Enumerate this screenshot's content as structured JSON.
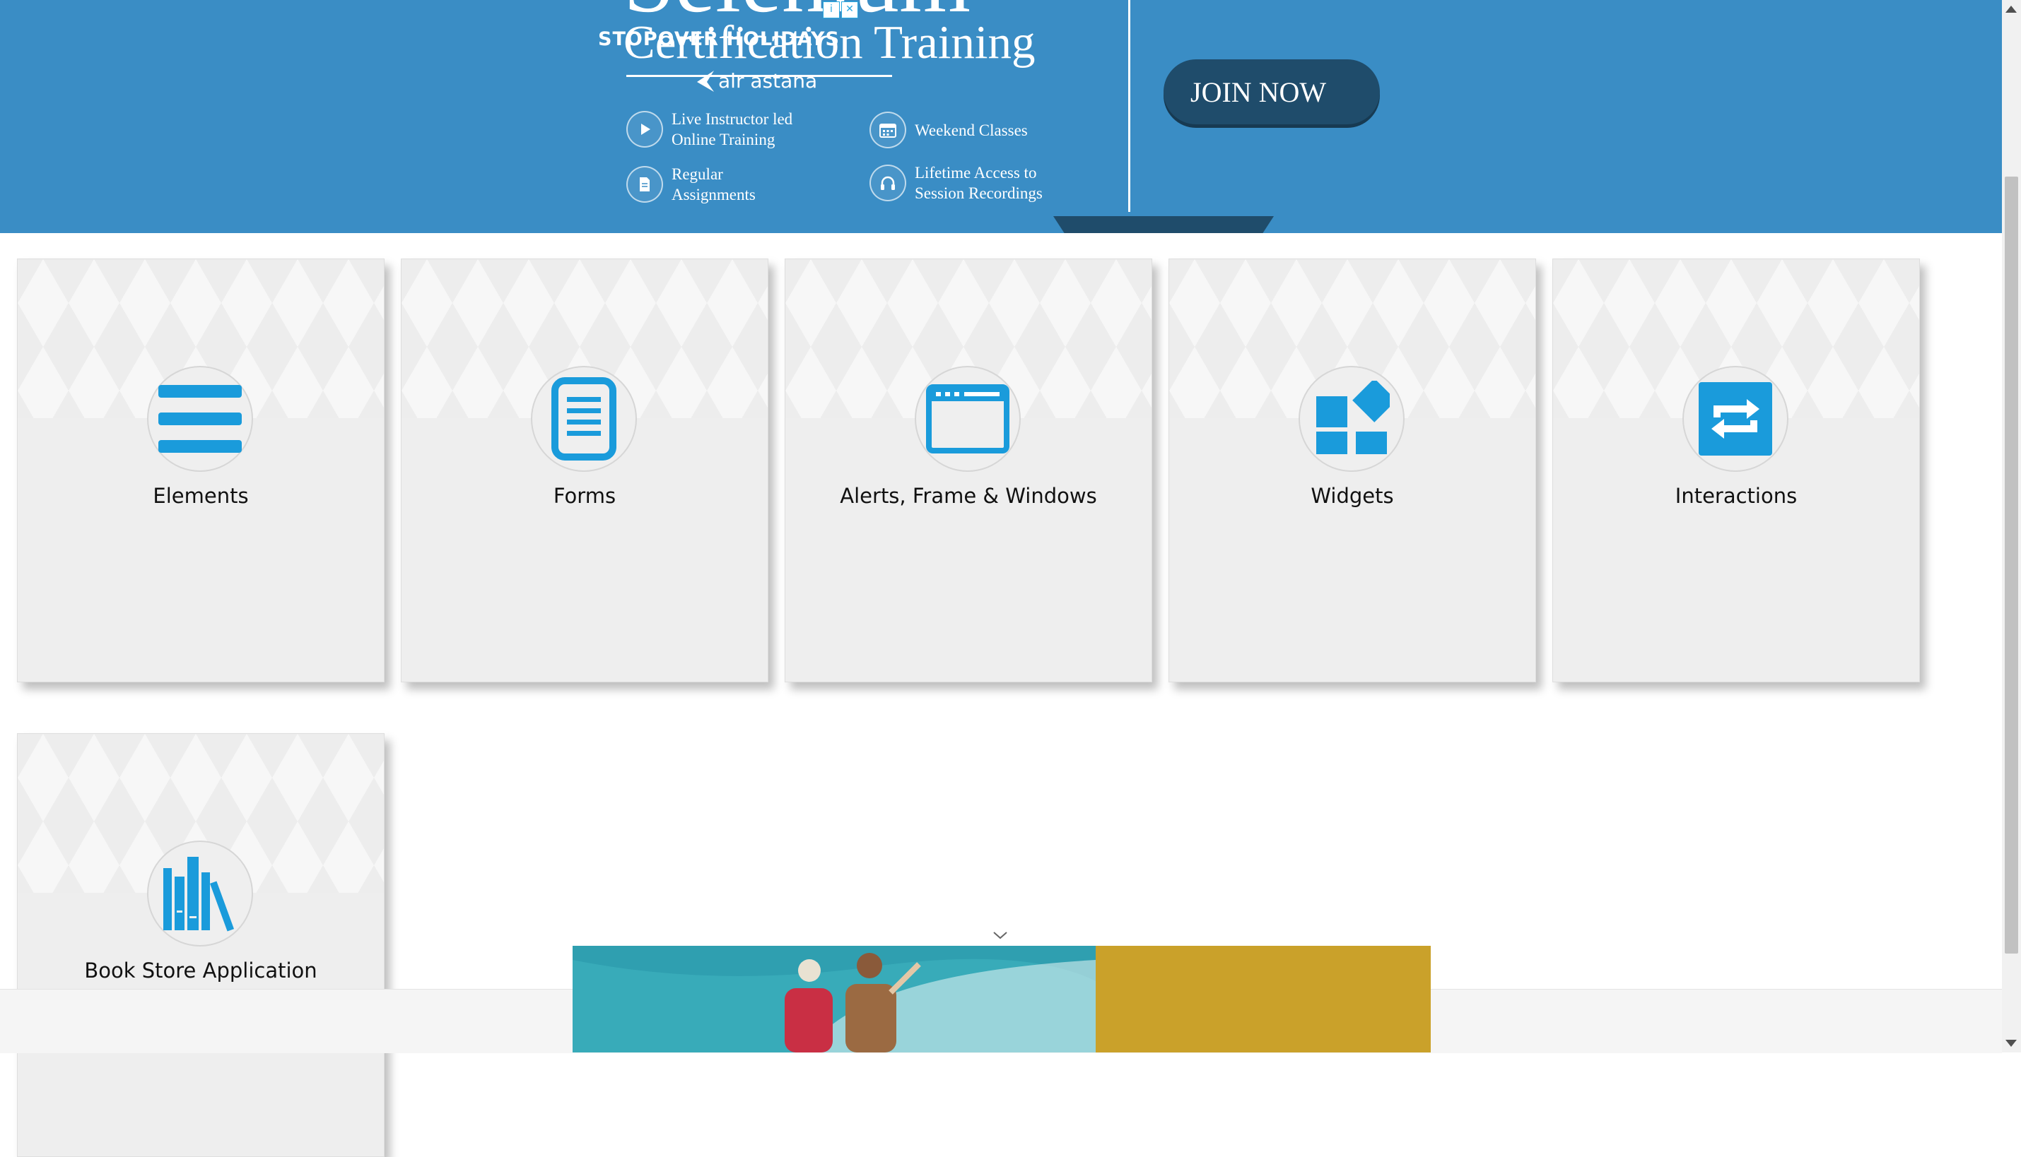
{
  "banner": {
    "title": "Selenium",
    "subtitle": "Certification Training",
    "features": [
      {
        "line1": "Live Instructor led",
        "line2": "Online Training",
        "icon": "play-icon"
      },
      {
        "line1": "Weekend Classes",
        "line2": "",
        "icon": "calendar-icon"
      },
      {
        "line1": "Regular",
        "line2": "Assignments",
        "icon": "document-icon"
      },
      {
        "line1": "Lifetime Access to",
        "line2": "Session Recordings",
        "icon": "headphones-icon"
      }
    ],
    "cta_label": "JOIN NOW",
    "colors": {
      "background": "#3a8dc5",
      "button": "#1f4c6b"
    }
  },
  "cards": [
    {
      "label": "Elements",
      "icon": "hamburger-menu-icon"
    },
    {
      "label": "Forms",
      "icon": "document-list-icon"
    },
    {
      "label": "Alerts, Frame & Windows",
      "icon": "browser-window-icon"
    },
    {
      "label": "Widgets",
      "icon": "widgets-icon"
    },
    {
      "label": "Interactions",
      "icon": "swap-arrows-icon"
    },
    {
      "label": "Book Store Application",
      "icon": "books-icon"
    }
  ],
  "card_icon_color": "#1a9bdb",
  "ad": {
    "headline": "STOPOVER HOLIDAYS",
    "brand": "air astana",
    "info_label": "i",
    "close_label": "✕",
    "colors": {
      "panel": "#caa12a"
    }
  }
}
